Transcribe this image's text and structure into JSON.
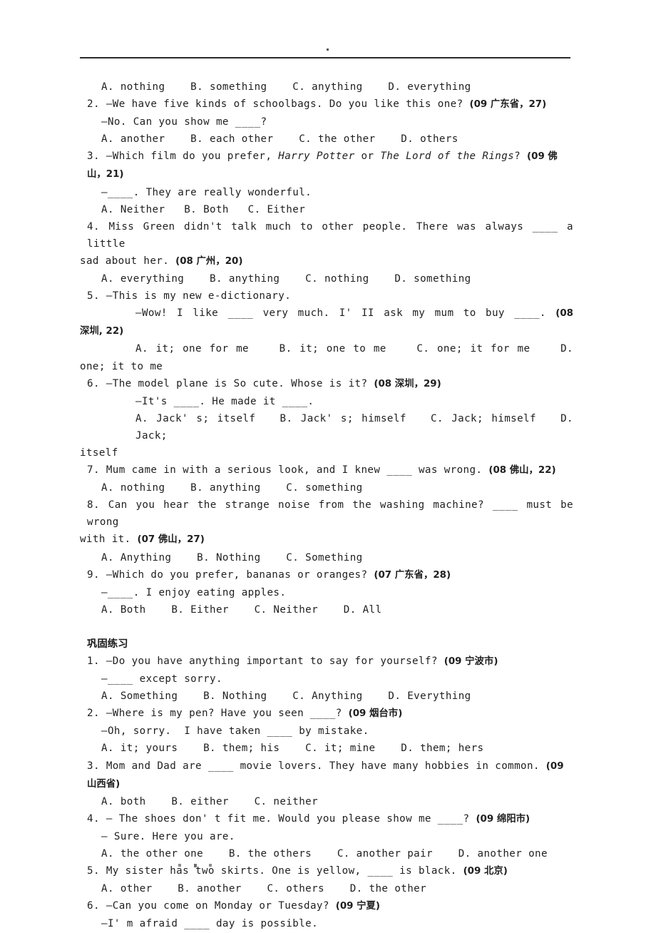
{
  "document": {
    "type": "worksheet-page",
    "header": {
      "rule": true,
      "mark": "."
    },
    "footer": {
      "marks": ". . ."
    },
    "sections": [
      {
        "id": "section-1",
        "heading": null,
        "lines": [
          {
            "id": "q1-options",
            "indent": "opt",
            "text": "A. nothing    B. something    C. anything    D. everything"
          },
          {
            "id": "q2-stem",
            "indent": "num",
            "text": "2. —We have five kinds of schoolbags. Do you like this one? ",
            "source": "(09 广东省，27)"
          },
          {
            "id": "q2-reply",
            "indent": "dash",
            "text": "—No. Can you show me ____?"
          },
          {
            "id": "q2-options",
            "indent": "opt",
            "text": "A. another    B. each other    C. the other    D. others"
          },
          {
            "id": "q3-stem",
            "indent": "num",
            "text_before": "3. —Which film do you prefer, ",
            "italic1": "Harry Potter",
            "text_mid": " or ",
            "italic2": "The Lord of the Rings",
            "text_after": "? ",
            "source": "(09 佛山，21)"
          },
          {
            "id": "q3-reply",
            "indent": "dash",
            "text": "—____. They are really wonderful."
          },
          {
            "id": "q3-options",
            "indent": "opt",
            "text": "A. Neither   B. Both   C. Either"
          },
          {
            "id": "q4-stem",
            "indent": "num",
            "justify": true,
            "text": "4. Miss Green didn't talk much to other people. There was always ____ a little"
          },
          {
            "id": "q4-stem-cont",
            "indent": "flush",
            "text": "sad about her. ",
            "source": "(08 广州，20)"
          },
          {
            "id": "q4-options",
            "indent": "opt",
            "text": "A. everything    B. anything    C. nothing    D. something"
          },
          {
            "id": "q5-stem",
            "indent": "num",
            "text": "5. —This is my new e-dictionary."
          },
          {
            "id": "q5-reply",
            "indent": "deep",
            "justify": true,
            "text": "—Wow! I like ____ very much. I' II ask my mum to buy ____. ",
            "source": "(08"
          },
          {
            "id": "q5-reply-cont",
            "indent": "flush",
            "source": "深圳, 22)"
          },
          {
            "id": "q5-options",
            "indent": "deep",
            "justify": true,
            "text": "A. it; one for me    B. it; one to me    C. one; it for me    D."
          },
          {
            "id": "q5-options-cont",
            "indent": "flush",
            "text": "one; it to me"
          },
          {
            "id": "q6-stem",
            "indent": "num",
            "text": "6. —The model plane is So cute. Whose is it? ",
            "source": "(08 深圳，29)"
          },
          {
            "id": "q6-reply",
            "indent": "deep",
            "text": "—It's ____. He made it ____."
          },
          {
            "id": "q6-options",
            "indent": "deep",
            "justify": true,
            "text": "A. Jack' s; itself   B. Jack' s; himself   C. Jack; himself   D. Jack;"
          },
          {
            "id": "q6-options-cont",
            "indent": "flush",
            "text": "itself"
          },
          {
            "id": "q7-stem",
            "indent": "num",
            "text": "7. Mum came in with a serious look, and I knew ____ was wrong. ",
            "source": "(08 佛山，22)"
          },
          {
            "id": "q7-options",
            "indent": "opt",
            "text": "A. nothing    B. anything    C. something"
          },
          {
            "id": "q8-stem",
            "indent": "num",
            "justify": true,
            "text": "8. Can you hear the strange noise from the washing machine? ____ must be wrong"
          },
          {
            "id": "q8-stem-cont",
            "indent": "flush",
            "text": "with it. ",
            "source": "(07 佛山，27)"
          },
          {
            "id": "q8-options",
            "indent": "opt",
            "text": "A. Anything    B. Nothing    C. Something"
          },
          {
            "id": "q9-stem",
            "indent": "num",
            "text": "9. —Which do you prefer, bananas or oranges? ",
            "source": "(07 广东省，28)"
          },
          {
            "id": "q9-reply",
            "indent": "dash",
            "text": "—____. I enjoy eating apples."
          },
          {
            "id": "q9-options",
            "indent": "opt",
            "text": "A. Both    B. Either    C. Neither    D. All"
          }
        ]
      },
      {
        "id": "section-2",
        "heading": "巩固练习",
        "lines": [
          {
            "id": "p1-stem",
            "indent": "num",
            "text": "1. —Do you have anything important to say for yourself? ",
            "source": "(09 宁波市)"
          },
          {
            "id": "p1-reply",
            "indent": "dash",
            "text": "—____ except sorry."
          },
          {
            "id": "p1-options",
            "indent": "opt",
            "text": "A. Something    B. Nothing    C. Anything    D. Everything"
          },
          {
            "id": "p2-stem",
            "indent": "num",
            "text": "2. —Where is my pen? Have you seen ____? ",
            "source": "(09 烟台市)"
          },
          {
            "id": "p2-reply",
            "indent": "dash",
            "text": "—Oh, sorry.  I have taken ____ by mistake."
          },
          {
            "id": "p2-options",
            "indent": "opt",
            "text": "A. it; yours    B. them; his    C. it; mine    D. them; hers"
          },
          {
            "id": "p3-stem",
            "indent": "num",
            "text": "3. Mom and Dad are ____ movie lovers. They have many hobbies in common. ",
            "source": "(09 山西省)"
          },
          {
            "id": "p3-options",
            "indent": "opt",
            "text": "A. both    B. either    C. neither"
          },
          {
            "id": "p4-stem",
            "indent": "num",
            "text": "4. — The shoes don' t fit me. Would you please show me ____? ",
            "source": "(09 绵阳市)"
          },
          {
            "id": "p4-reply",
            "indent": "dash",
            "text": "— Sure. Here you are."
          },
          {
            "id": "p4-options",
            "indent": "opt",
            "text": "A. the other one    B. the others    C. another pair    D. another one"
          },
          {
            "id": "p5-stem",
            "indent": "num",
            "text": "5. My sister has two skirts. One is yellow, ____ is black. ",
            "source": "(09 北京)"
          },
          {
            "id": "p5-options",
            "indent": "opt",
            "text": "A. other    B. another    C. others    D. the other"
          },
          {
            "id": "p6-stem",
            "indent": "num",
            "text": "6. —Can you come on Monday or Tuesday? ",
            "source": "(09 宁夏)"
          },
          {
            "id": "p6-reply",
            "indent": "dash",
            "text": "—I' m afraid ____ day is possible."
          }
        ]
      }
    ]
  }
}
